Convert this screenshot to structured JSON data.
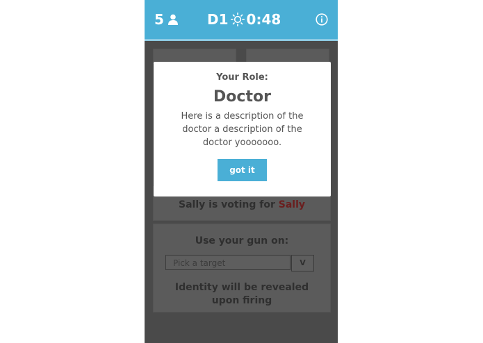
{
  "header": {
    "player_count": "5",
    "day": "D1",
    "timer": "0:48"
  },
  "vote": {
    "voter": "Sally",
    "text": "is voting for",
    "target": "Sally"
  },
  "gun": {
    "title": "Use your gun on:",
    "select_placeholder": "Pick a target",
    "select_button": "V",
    "note": "Identity will be revealed upon firing"
  },
  "modal": {
    "label": "Your Role:",
    "role": "Doctor",
    "description": "Here is a description of the doctor a description of the doctor yooooooo.",
    "button": "got it"
  },
  "colors": {
    "accent": "#4aafd6",
    "overlay": "#4a4a4a",
    "vote_target": "#6a1e1e"
  }
}
